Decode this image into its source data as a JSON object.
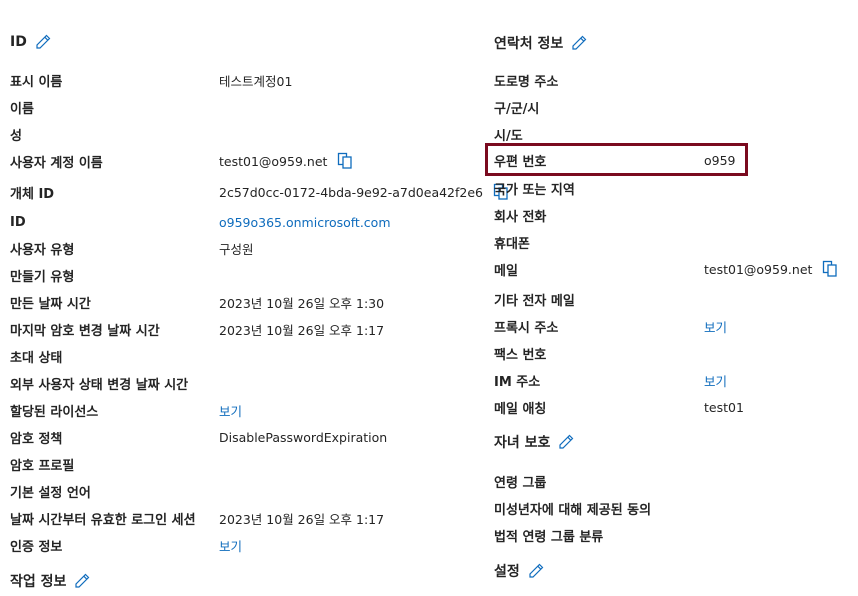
{
  "left": {
    "identity": {
      "title": "ID",
      "display_name_label": "표시 이름",
      "display_name_value": "테스트계정01",
      "first_name_label": "이름",
      "last_name_label": "성",
      "upn_label": "사용자 계정 이름",
      "upn_value": "test01@o959.net",
      "object_id_label": "개체 ID",
      "object_id_value": "2c57d0cc-0172-4bda-9e92-a7d0ea42f2e6",
      "id_label": "ID",
      "id_value": "o959o365.onmicrosoft.com",
      "user_type_label": "사용자 유형",
      "user_type_value": "구성원",
      "creation_type_label": "만들기 유형",
      "created_label": "만든 날짜 시간",
      "created_value": "2023년 10월 26일 오후 1:30",
      "last_pwd_change_label": "마지막 암호 변경 날짜 시간",
      "last_pwd_change_value": "2023년 10월 26일 오후 1:17",
      "invite_state_label": "초대 상태",
      "external_state_change_label": "외부 사용자 상태 변경 날짜 시간",
      "licenses_label": "할당된 라이선스",
      "licenses_value": "보기",
      "pwd_policy_label": "암호 정책",
      "pwd_policy_value": "DisablePasswordExpiration",
      "pwd_profile_label": "암호 프로필",
      "pref_lang_label": "기본 설정 언어",
      "signin_sessions_label": "날짜 시간부터 유효한 로그인 세션",
      "signin_sessions_value": "2023년 10월 26일 오후 1:17",
      "auth_label": "인증 정보",
      "auth_value": "보기"
    },
    "job_title": "작업 정보"
  },
  "right": {
    "contact": {
      "title": "연락처 정보",
      "street_label": "도로명 주소",
      "city_label": "구/군/시",
      "state_label": "시/도",
      "zip_label": "우편 번호",
      "zip_value": "o959",
      "country_label": "국가 또는 지역",
      "office_phone_label": "회사 전화",
      "mobile_label": "휴대폰",
      "email_label": "메일",
      "email_value": "test01@o959.net",
      "other_email_label": "기타 전자 메일",
      "proxy_label": "프록시 주소",
      "proxy_value": "보기",
      "fax_label": "팩스 번호",
      "im_label": "IM 주소",
      "im_value": "보기",
      "mail_nickname_label": "메일 애칭",
      "mail_nickname_value": "test01"
    },
    "parental": {
      "title": "자녀 보호",
      "age_group_label": "연령 그룹",
      "consent_label": "미성년자에 대해 제공된 동의",
      "legal_age_label": "법적 연령 그룹 분류"
    },
    "settings_title": "설정"
  },
  "colors": {
    "link": "#0f6cbd",
    "highlight": "#7a0a1f",
    "text": "#242424"
  }
}
